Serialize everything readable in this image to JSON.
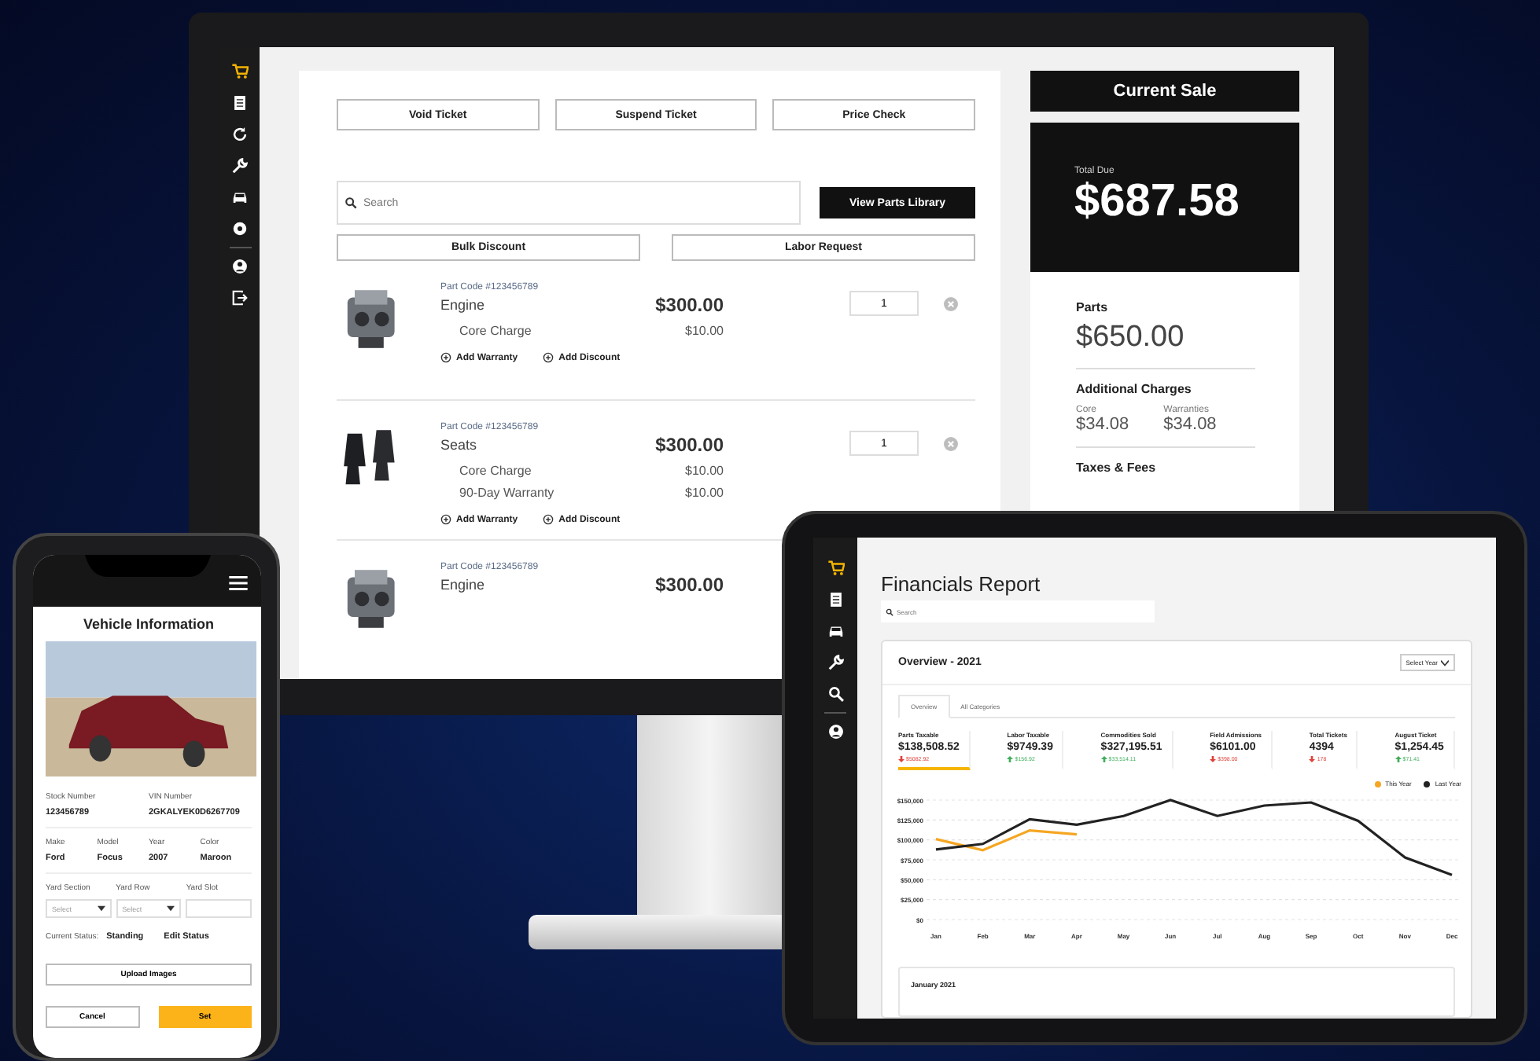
{
  "monitor": {
    "sidebar": [
      {
        "selected": true
      },
      {
        "selected": false
      },
      {
        "selected": false
      },
      {
        "selected": false
      },
      {
        "selected": false
      },
      {
        "selected": false
      },
      {
        "selected": false
      },
      {
        "selected": false
      }
    ],
    "actions": [
      "Void Ticket",
      "Suspend Ticket",
      "Price Check"
    ],
    "search": {
      "placeholder": "Search"
    },
    "library_button": "View Parts Library",
    "secondary_actions": [
      "Bulk Discount",
      "Labor Request"
    ],
    "items": [
      {
        "kind": "engine",
        "code": "Part Code #123456789",
        "name": "Engine",
        "price": "$300.00",
        "charges": [
          {
            "label": "Core Charge",
            "amount": "$10.00"
          }
        ],
        "links": [
          "Add Warranty",
          "Add Discount"
        ],
        "quantity": "1"
      },
      {
        "kind": "seats",
        "code": "Part Code #123456789",
        "name": "Seats",
        "price": "$300.00",
        "charges": [
          {
            "label": "Core Charge",
            "amount": "$10.00"
          },
          {
            "label": "90-Day Warranty",
            "amount": "$10.00"
          }
        ],
        "links": [
          "Add Warranty",
          "Add Discount"
        ],
        "quantity": "1"
      },
      {
        "kind": "engine",
        "code": "Part Code #123456789",
        "name": "Engine",
        "price": "$300.00"
      }
    ],
    "sale": {
      "title": "Current Sale",
      "total_label": "Total Due",
      "total": "$687.58",
      "parts_label": "Parts",
      "parts": "$650.00",
      "additional_label": "Additional Charges",
      "charges": [
        {
          "label": "Core",
          "amount": "$34.08"
        },
        {
          "label": "Warranties",
          "amount": "$34.08"
        }
      ],
      "taxes_label": "Taxes & Fees"
    }
  },
  "phone": {
    "title": "Vehicle Information",
    "pairs": [
      {
        "label": "Stock Number",
        "value": "123456789"
      },
      {
        "label": "VIN Number",
        "value": "2GKALYEK0D6267709"
      }
    ],
    "specs": [
      {
        "label": "Make",
        "value": "Ford"
      },
      {
        "label": "Model",
        "value": "Focus"
      },
      {
        "label": "Year",
        "value": "2007"
      },
      {
        "label": "Color",
        "value": "Maroon"
      }
    ],
    "yard": [
      {
        "kind": "select",
        "label": "Yard Section",
        "placeholder": "Select"
      },
      {
        "kind": "select",
        "label": "Yard Row",
        "placeholder": "Select"
      },
      {
        "kind": "input",
        "label": "Yard Slot"
      }
    ],
    "status_label": "Current Status:",
    "status": "Standing",
    "edit_status": "Edit Status",
    "upload": "Upload Images",
    "cancel": "Cancel",
    "submit": "Set"
  },
  "tablet": {
    "sidebar": [
      {
        "selected": true
      },
      {
        "selected": false
      },
      {
        "selected": false
      },
      {
        "selected": false
      },
      {
        "selected": false
      },
      {
        "selected": false
      }
    ],
    "title": "Financials Report",
    "search": {
      "placeholder": "Search"
    },
    "overview": {
      "title": "Overview - 2021",
      "year_select": "Select Year",
      "tabs": [
        {
          "label": "Overview",
          "selected": true
        },
        {
          "label": "All Categories",
          "selected": false
        }
      ],
      "stats": [
        {
          "label": "Parts Taxable",
          "value": "$138,508.52",
          "change": "$5082.92",
          "rising": false,
          "selected": true
        },
        {
          "label": "Labor Taxable",
          "value": "$9749.39",
          "change": "$156.92",
          "rising": true,
          "selected": false
        },
        {
          "label": "Commodities Sold",
          "value": "$327,195.51",
          "change": "$33,514.11",
          "rising": true,
          "selected": false
        },
        {
          "label": "Field Admissions",
          "value": "$6101.00",
          "change": "$398.00",
          "rising": false,
          "selected": false
        },
        {
          "label": "Total Tickets",
          "value": "4394",
          "change": "178",
          "rising": false,
          "selected": false
        },
        {
          "label": "August Ticket",
          "value": "$1,254.45",
          "change": "$71.41",
          "rising": true,
          "selected": false
        }
      ],
      "chart_data": {
        "type": "line",
        "categories": [
          "Jan",
          "Feb",
          "Mar",
          "Apr",
          "May",
          "Jun",
          "Jul",
          "Aug",
          "Sep",
          "Oct",
          "Nov",
          "Dec"
        ],
        "series": [
          {
            "name": "This Year",
            "color": "#f5a623",
            "values": [
              101000,
              87000,
              112000,
              107000,
              null,
              null,
              null,
              null,
              null,
              null,
              null,
              null
            ]
          },
          {
            "name": "Last Year",
            "color": "#222222",
            "values": [
              88000,
              95000,
              126000,
              119000,
              130000,
              150000,
              130000,
              143000,
              147000,
              124000,
              78000,
              56000
            ]
          }
        ],
        "ylim": [
          0,
          150000
        ],
        "grid": true,
        "yticks": [
          {
            "value": 0,
            "label": "$0"
          },
          {
            "value": 25000,
            "label": "$25,000"
          },
          {
            "value": 50000,
            "label": "$50,000"
          },
          {
            "value": 75000,
            "label": "$75,000"
          },
          {
            "value": 100000,
            "label": "$100,000"
          },
          {
            "value": 125000,
            "label": "$125,000"
          },
          {
            "value": 150000,
            "label": "$150,000"
          }
        ]
      },
      "month_card": "January 2021"
    }
  }
}
